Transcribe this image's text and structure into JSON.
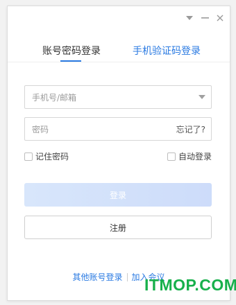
{
  "tabs": {
    "account_label": "账号密码登录",
    "phone_label": "手机验证码登录",
    "active": "account"
  },
  "form": {
    "account_placeholder": "手机号/邮箱",
    "password_placeholder": "密码",
    "forgot_label": "忘记了?",
    "remember_label": "记住密码",
    "auto_login_label": "自动登录"
  },
  "buttons": {
    "login_label": "登录",
    "register_label": "注册"
  },
  "footer": {
    "other_account_label": "其他账号登录",
    "join_meeting_label": "加入会议"
  },
  "watermark": {
    "text": "ITMOP.COM"
  },
  "colors": {
    "accent": "#2a7ae2",
    "login_button": "#d8e6fb",
    "watermark": "#17b04b"
  },
  "icons": {
    "menu": "chevron-down-icon",
    "minimize": "minimize-icon",
    "close": "close-icon",
    "dropdown": "dropdown-arrow-icon"
  }
}
